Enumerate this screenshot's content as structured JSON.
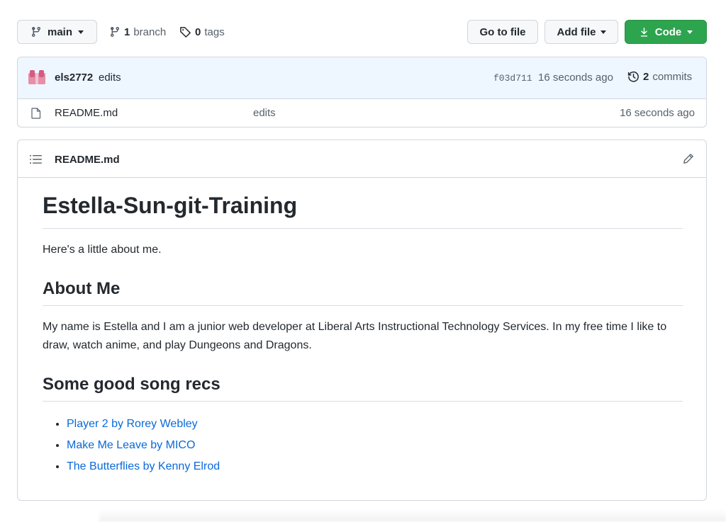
{
  "toolbar": {
    "branch_name": "main",
    "branch_count": "1",
    "branch_label": "branch",
    "tag_count": "0",
    "tag_label": "tags",
    "go_to_file": "Go to file",
    "add_file": "Add file",
    "code": "Code"
  },
  "commit": {
    "author": "els2772",
    "message": "edits",
    "sha": "f03d711",
    "time": "16 seconds ago",
    "commit_count": "2",
    "commit_label": "commits"
  },
  "files": [
    {
      "name": "README.md",
      "message": "edits",
      "time": "16 seconds ago"
    }
  ],
  "readme": {
    "header_title": "README.md",
    "h1": "Estella-Sun-git-Training",
    "intro": "Here's a little about me.",
    "about_heading": "About Me",
    "about_text": "My name is Estella and I am a junior web developer at Liberal Arts Instructional Technology Services. In my free time I like to draw, watch anime, and play Dungeons and Dragons.",
    "songs_heading": "Some good song recs",
    "songs": [
      "Player 2 by Rorey Webley",
      "Make Me Leave by MICO",
      "The Butterflies by Kenny Elrod"
    ]
  },
  "colors": {
    "accent_green": "#2da44e",
    "link_blue": "#0969da",
    "commit_bar_bg": "#eef6ff",
    "avatar_pink": "#e06c8c"
  },
  "icons": {
    "branch": "git-branch-icon",
    "tag": "tag-icon",
    "download": "download-icon",
    "history": "history-icon",
    "file": "file-icon",
    "list": "list-unordered-icon",
    "edit": "pencil-icon"
  }
}
